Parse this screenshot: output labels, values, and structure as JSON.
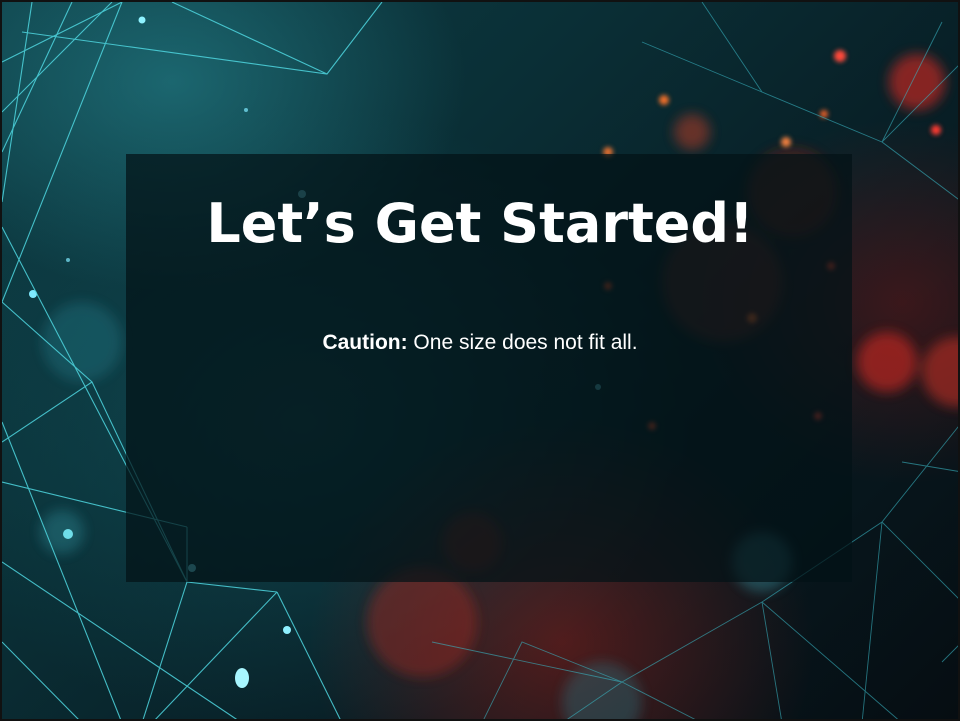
{
  "slide": {
    "title": "Let’s Get Started!",
    "subtitle_label": "Caution:",
    "subtitle_text": " One size does not fit all."
  },
  "colors": {
    "background_teal": "#0a2f36",
    "background_dark": "#060d12",
    "line_cyan": "#4fd6e0",
    "bokeh_red": "#e0372a",
    "text": "#ffffff"
  }
}
